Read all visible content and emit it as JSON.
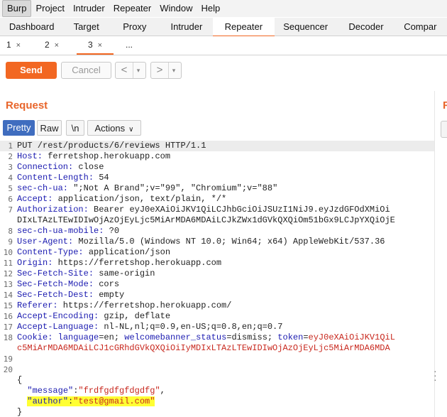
{
  "menubar": {
    "items": [
      "Burp",
      "Project",
      "Intruder",
      "Repeater",
      "Window",
      "Help"
    ]
  },
  "main_tabs": {
    "items": [
      "Dashboard",
      "Target",
      "Proxy",
      "Intruder",
      "Repeater",
      "Sequencer",
      "Decoder",
      "Compar"
    ],
    "active": "Repeater"
  },
  "sub_tabs": {
    "items": [
      "1",
      "2",
      "3",
      "..."
    ],
    "close_glyph": "×",
    "active": "3"
  },
  "toolbar": {
    "send_label": "Send",
    "cancel_label": "Cancel",
    "back_icon": "<",
    "forward_icon": ">",
    "dropdown_icon": "▾"
  },
  "request": {
    "title": "Request",
    "view_tabs": {
      "pretty": "Pretty",
      "raw": "Raw",
      "newline": "\\n",
      "actions": "Actions"
    },
    "lines": [
      {
        "n": "1",
        "text": "PUT /rest/products/6/reviews HTTP/1.1"
      },
      {
        "n": "2",
        "name": "Host:",
        "value": " ferretshop.herokuapp.com"
      },
      {
        "n": "3",
        "name": "Connection:",
        "value": " close"
      },
      {
        "n": "4",
        "name": "Content-Length:",
        "value": " 54"
      },
      {
        "n": "5",
        "name": "sec-ch-ua:",
        "value": " \";Not A Brand\";v=\"99\", \"Chromium\";v=\"88\""
      },
      {
        "n": "6",
        "name": "Accept:",
        "value": " application/json, text/plain, */*"
      },
      {
        "n": "7",
        "name": "Authorization:",
        "value": " Bearer eyJ0eXAiOiJKV1QiLCJhbGciOiJSUzI1NiJ9.eyJzdGFOdXMiOi"
      },
      {
        "n": "",
        "text": "DIxLTAzLTEwIDIwOjAzOjEyLjc5MiArMDA6MDAiLCJkZWx1dGVkQXQiOm51bGx9LCJpYXQiOjE"
      },
      {
        "n": "8",
        "name": "sec-ch-ua-mobile:",
        "value": " ?0"
      },
      {
        "n": "9",
        "name": "User-Agent:",
        "value": " Mozilla/5.0 (Windows NT 10.0; Win64; x64) AppleWebKit/537.36"
      },
      {
        "n": "10",
        "name": "Content-Type:",
        "value": " application/json"
      },
      {
        "n": "11",
        "name": "Origin:",
        "value": " https://ferretshop.herokuapp.com"
      },
      {
        "n": "12",
        "name": "Sec-Fetch-Site:",
        "value": " same-origin"
      },
      {
        "n": "13",
        "name": "Sec-Fetch-Mode:",
        "value": " cors"
      },
      {
        "n": "14",
        "name": "Sec-Fetch-Dest:",
        "value": " empty"
      },
      {
        "n": "15",
        "name": "Referer:",
        "value": " https://ferretshop.herokuapp.com/"
      },
      {
        "n": "16",
        "name": "Accept-Encoding:",
        "value": " gzip, deflate"
      },
      {
        "n": "17",
        "name": "Accept-Language:",
        "value": " nl-NL,nl;q=0.9,en-US;q=0.8,en;q=0.7"
      },
      {
        "n": "18",
        "cookie": true,
        "name": "Cookie:",
        "parts": [
          {
            "t": " "
          },
          {
            "k": "language"
          },
          {
            "t": "=en; "
          },
          {
            "k": "welcomebanner_status"
          },
          {
            "t": "=dismiss; "
          },
          {
            "k": "token"
          },
          {
            "t": "="
          },
          {
            "v": "eyJ0eXAiOiJKV1QiL"
          }
        ]
      },
      {
        "n": "",
        "cont_cookie": true,
        "text": "c5MiArMDA6MDAiLCJ1cGRhdGVkQXQiOiIyMDIxLTAzLTEwIDIwOjAzOjEyLjc5MiArMDA6MDA"
      },
      {
        "n": "19",
        "text": ""
      },
      {
        "n": "20",
        "text": ""
      },
      {
        "n": "",
        "text": "{"
      },
      {
        "n": "",
        "json": true,
        "key": "\"message\"",
        "sep": ":",
        "value": "\"frdfgdfgfdgdfg\"",
        "tail": ","
      },
      {
        "n": "",
        "json": true,
        "highlight": true,
        "key": "\"author\"",
        "sep": ":",
        "value": "\"test@gmail.com\"",
        "tail": ""
      },
      {
        "n": "",
        "text": "}"
      }
    ]
  },
  "colors": {
    "accent": "#f26722",
    "pretty_tab": "#3f6dbf",
    "header_name": "#1a1ab0",
    "cookie_value": "#c8281e",
    "highlight": "#ffff33"
  }
}
